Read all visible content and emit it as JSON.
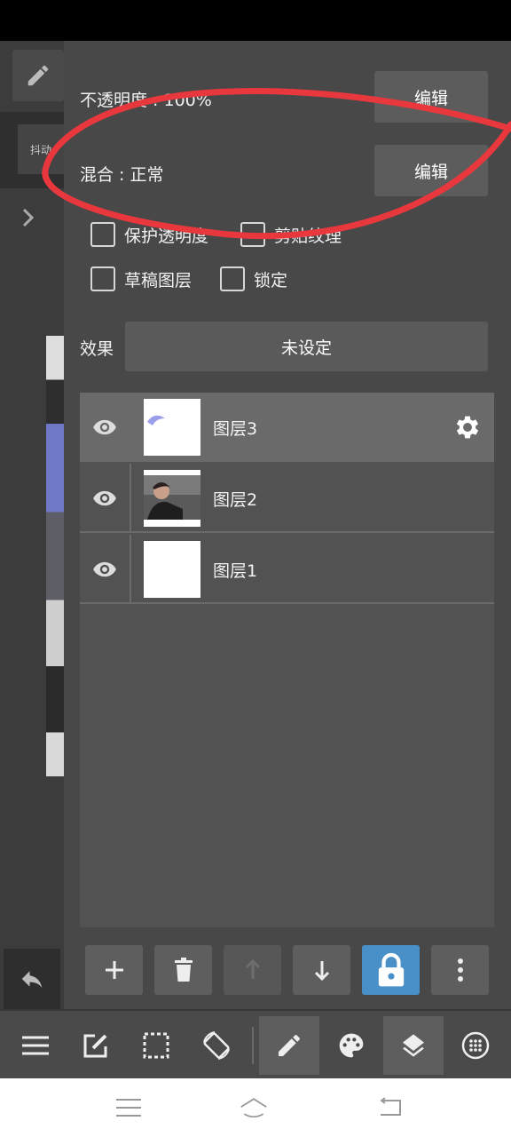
{
  "properties": {
    "opacity_label": "不透明度 : 100%",
    "blend_label": "混合 : 正常",
    "edit_label": "编辑",
    "edit_label_2": "编辑"
  },
  "options": {
    "protect_alpha": "保护透明度",
    "clipping": "剪贴纹理",
    "draft_layer": "草稿图层",
    "lock": "锁定"
  },
  "effect": {
    "label": "效果",
    "value": "未设定"
  },
  "left_panel": {
    "tab_text": "抖动"
  },
  "layers": [
    {
      "name": "图层3",
      "selected": true
    },
    {
      "name": "图层2",
      "selected": false
    },
    {
      "name": "图层1",
      "selected": false
    }
  ],
  "colors": {
    "accent": "#4a90c8",
    "annotation": "#e8383d"
  },
  "icons": {
    "layer_tools": [
      "plus-icon",
      "trash-icon",
      "arrow-up-icon",
      "arrow-down-icon",
      "lock-icon",
      "more-vertical-icon"
    ],
    "toolbar": [
      "menu-icon",
      "edit-icon",
      "selection-icon",
      "rotate-icon",
      "brush-icon",
      "palette-icon",
      "layers-icon",
      "grid-icon"
    ]
  }
}
